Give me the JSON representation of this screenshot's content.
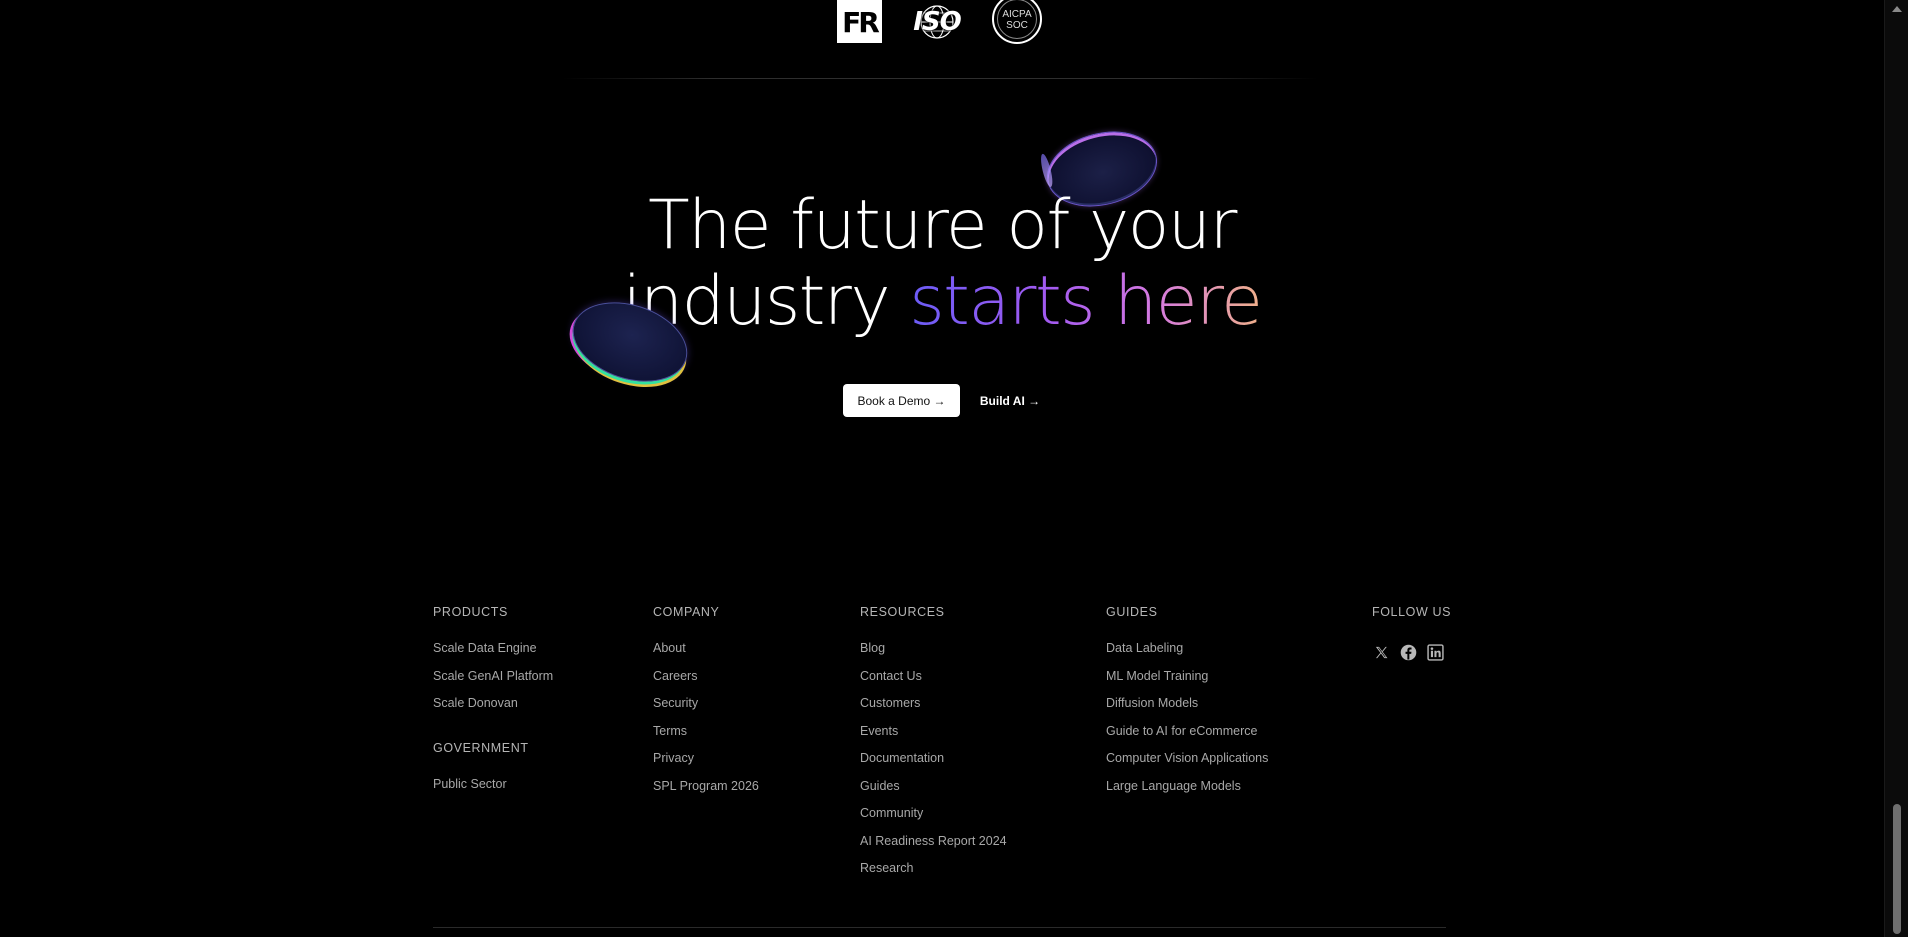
{
  "certifications": {
    "fr_label": "FR",
    "iso_label": "ISO",
    "aicpa_line1": "AICPA",
    "aicpa_line2": "SOC"
  },
  "hero": {
    "line1": "The future of your",
    "line2_plain": "industry ",
    "line2_gradient": "starts here",
    "gradient_colors": [
      "#6b5cf6",
      "#a35af0",
      "#d57ae0",
      "#f0b08a"
    ]
  },
  "cta": {
    "demo_label": "Book a Demo →",
    "build_label": "Build AI →"
  },
  "footer": {
    "products": {
      "heading": "PRODUCTS",
      "links": [
        "Scale Data Engine",
        "Scale GenAI Platform",
        "Scale Donovan"
      ]
    },
    "government": {
      "heading": "GOVERNMENT",
      "links": [
        "Public Sector"
      ]
    },
    "company": {
      "heading": "COMPANY",
      "links": [
        "About",
        "Careers",
        "Security",
        "Terms",
        "Privacy",
        "SPL Program 2026"
      ]
    },
    "resources": {
      "heading": "RESOURCES",
      "links": [
        "Blog",
        "Contact Us",
        "Customers",
        "Events",
        "Documentation",
        "Guides",
        "Community",
        "AI Readiness Report 2024",
        "Research"
      ]
    },
    "guides": {
      "heading": "GUIDES",
      "links": [
        "Data Labeling",
        "ML Model Training",
        "Diffusion Models",
        "Guide to AI for eCommerce",
        "Computer Vision Applications",
        "Large Language Models"
      ]
    },
    "follow": {
      "heading": "FOLLOW US",
      "icons": [
        "x-icon",
        "facebook-icon",
        "linkedin-icon"
      ]
    }
  }
}
